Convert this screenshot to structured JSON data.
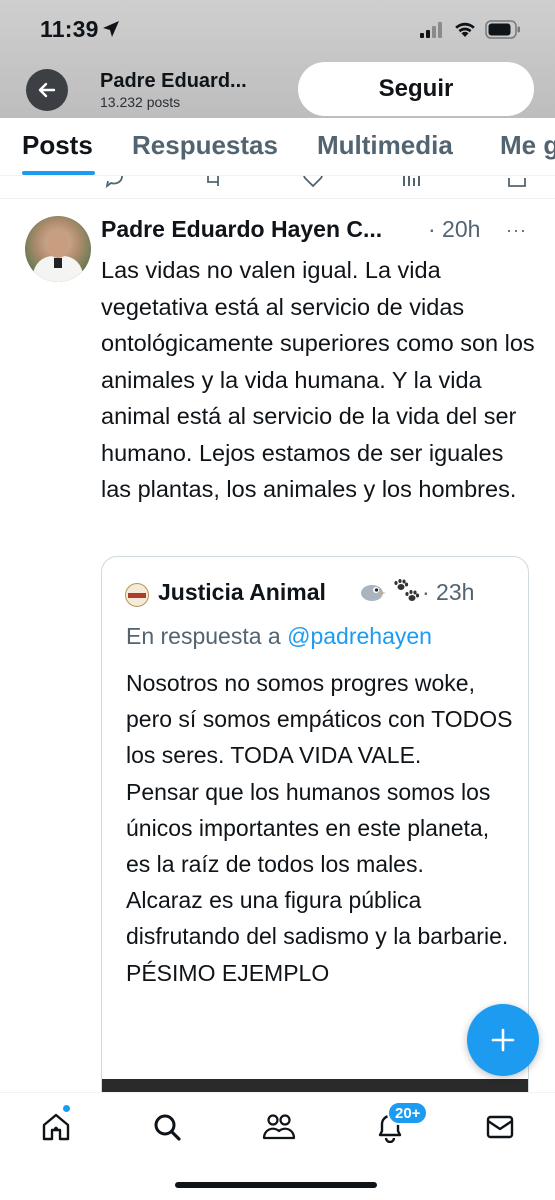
{
  "status_bar": {
    "time": "11:39"
  },
  "header": {
    "profile_name": "Padre Eduard...",
    "post_count": "13.232 posts",
    "follow_label": "Seguir"
  },
  "tabs": [
    {
      "label": "Posts"
    },
    {
      "label": "Respuestas"
    },
    {
      "label": "Multimedia"
    },
    {
      "label": "Me g"
    }
  ],
  "tweet": {
    "author": "Padre Eduardo Hayen C...",
    "time": "· 20h",
    "more": "···",
    "text": "Las vidas no valen igual. La vida vegetativa está al servicio de vidas ontológicamente superiores como son los animales y la vida humana. Y la vida animal está al servicio de la vida del ser humano. Lejos estamos de ser iguales las plantas, los animales y los hombres.",
    "quote": {
      "author": "Justicia Animal",
      "time": "· 23h",
      "reply_prefix": "En respuesta a ",
      "reply_handle": "@padrehayen",
      "text": "Nosotros no somos progres woke, pero sí somos empáticos con TODOS los seres. TODA  VIDA VALE.\nPensar que los humanos somos los únicos importantes en este planeta, es la raíz de todos los males.\nAlcaraz es una figura pública disfrutando del sadismo y la barbarie. PÉSIMO EJEMPLO"
    }
  },
  "bottom_nav": {
    "notifications_badge": "20+"
  },
  "colors": {
    "accent": "#1d9bf0",
    "text_primary": "#0f1419",
    "text_secondary": "#536471"
  }
}
